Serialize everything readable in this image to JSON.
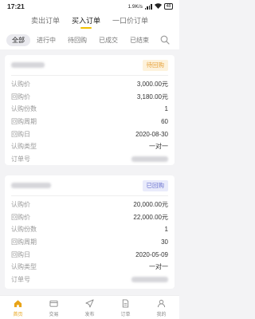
{
  "status_bar": {
    "time": "17:21",
    "speed": "1.9K/s",
    "battery": "48"
  },
  "top_tabs": [
    {
      "label": "卖出订单",
      "active": false
    },
    {
      "label": "买入订单",
      "active": true
    },
    {
      "label": "一口价订单",
      "active": false
    }
  ],
  "filters": [
    {
      "label": "全部",
      "active": true
    },
    {
      "label": "进行中",
      "active": false
    },
    {
      "label": "待回购",
      "active": false
    },
    {
      "label": "已成交",
      "active": false
    },
    {
      "label": "已结束",
      "active": false
    }
  ],
  "orders": [
    {
      "status": "待回购",
      "rows": [
        {
          "label": "认购价",
          "value": "3,000.00元"
        },
        {
          "label": "回购价",
          "value": "3,180.00元"
        },
        {
          "label": "认购份数",
          "value": "1"
        },
        {
          "label": "回购周期",
          "value": "60"
        },
        {
          "label": "回购日",
          "value": "2020-08-30"
        },
        {
          "label": "认购类型",
          "value": "一对一"
        },
        {
          "label": "订单号",
          "value": ""
        }
      ]
    },
    {
      "status": "已回购",
      "rows": [
        {
          "label": "认购价",
          "value": "20,000.00元"
        },
        {
          "label": "回购价",
          "value": "22,000.00元"
        },
        {
          "label": "认购份数",
          "value": "1"
        },
        {
          "label": "回购周期",
          "value": "30"
        },
        {
          "label": "回购日",
          "value": "2020-05-09"
        },
        {
          "label": "认购类型",
          "value": "一对一"
        },
        {
          "label": "订单号",
          "value": ""
        }
      ]
    }
  ],
  "bottom_tabs": [
    {
      "label": "首页",
      "icon": "home-icon",
      "active": true
    },
    {
      "label": "交易",
      "icon": "wallet-icon",
      "active": false
    },
    {
      "label": "发布",
      "icon": "send-icon",
      "active": false
    },
    {
      "label": "订单",
      "icon": "document-icon",
      "active": false
    },
    {
      "label": "我的",
      "icon": "user-icon",
      "active": false
    }
  ],
  "colors": {
    "accent": "#f0c000",
    "pending": "#e6a23c",
    "done": "#6b73cf"
  }
}
